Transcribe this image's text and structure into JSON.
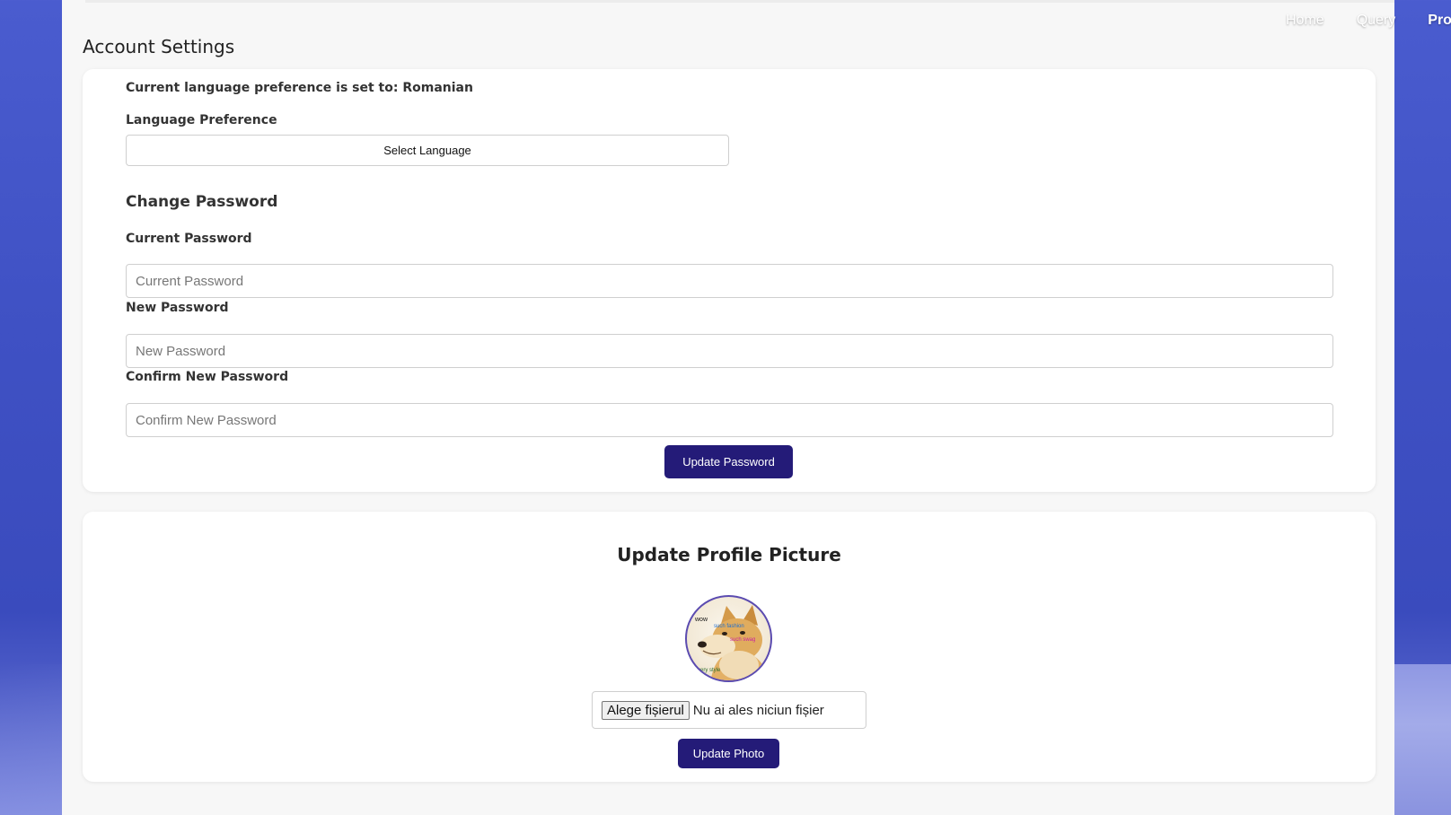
{
  "nav": {
    "items": [
      "Home",
      "Query",
      "Pro"
    ]
  },
  "page": {
    "title": "Account Settings"
  },
  "settings": {
    "current_language_text": "Current language preference is set to: Romanian",
    "language_label": "Language Preference",
    "language_select": "Select Language",
    "change_password_title": "Change Password",
    "current_password_label": "Current Password",
    "current_password_placeholder": "Current Password",
    "new_password_label": "New Password",
    "new_password_placeholder": "New Password",
    "confirm_password_label": "Confirm New Password",
    "confirm_password_placeholder": "Confirm New Password",
    "update_password_button": "Update Password"
  },
  "photo": {
    "title": "Update Profile Picture",
    "file_button": "Alege fișierul",
    "file_status": "Nu ai ales niciun fișier",
    "update_photo_button": "Update Photo",
    "meme_text": [
      "wow",
      "such fashion",
      "such swag",
      "very style"
    ]
  },
  "colors": {
    "accent": "#241b78",
    "background": "#3f51c4",
    "panel": "#f7f7f7",
    "card": "#ffffff"
  }
}
